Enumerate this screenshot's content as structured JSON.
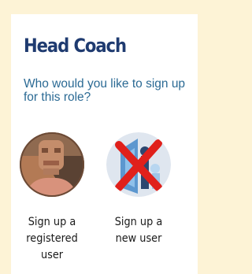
{
  "role": {
    "title": "Head Coach",
    "prompt": "Who would you like to sign up for this role?"
  },
  "options": [
    {
      "label": "Sign up a registered user",
      "icon": "user-photo-icon"
    },
    {
      "label": "Sign up a new user",
      "icon": "new-user-crossed-icon"
    }
  ],
  "colors": {
    "page_background": "#fdf3d6",
    "title": "#1f3b70",
    "prompt": "#2b6a94",
    "cross": "#e0201b"
  }
}
